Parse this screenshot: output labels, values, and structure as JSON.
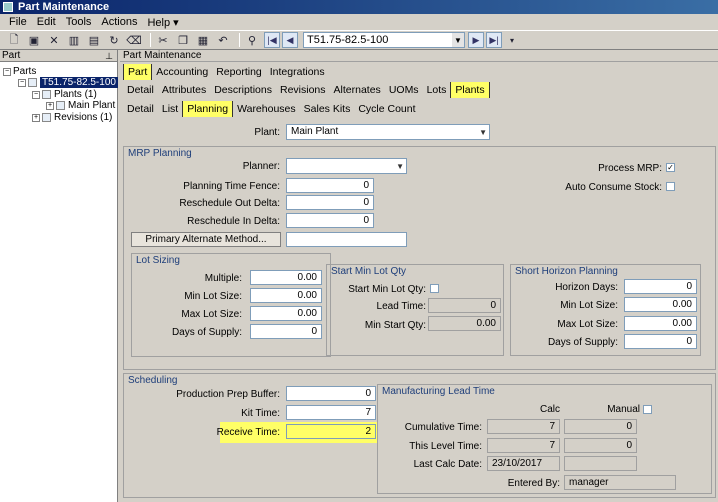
{
  "window": {
    "title": "Part Maintenance"
  },
  "menu": {
    "file": "File",
    "edit": "Edit",
    "tools": "Tools",
    "actions": "Actions",
    "help": "Help"
  },
  "toolbar": {
    "nav_value": "T51.75-82.5-100"
  },
  "tree": {
    "header": "Part",
    "root": "Parts",
    "part": "T51.75-82.5-100",
    "plants": "Plants (1)",
    "main_plant": "Main Plant",
    "revisions": "Revisions (1)"
  },
  "main": {
    "header": "Part Maintenance",
    "tabs1": [
      "Part",
      "Accounting",
      "Reporting",
      "Integrations"
    ],
    "tabs2": [
      "Detail",
      "Attributes",
      "Descriptions",
      "Revisions",
      "Alternates",
      "UOMs",
      "Lots",
      "Plants"
    ],
    "tabs3": [
      "Detail",
      "List",
      "Planning",
      "Warehouses",
      "Sales Kits",
      "Cycle Count"
    ]
  },
  "plant": {
    "label": "Plant:",
    "value": "Main Plant"
  },
  "mrp": {
    "title": "MRP Planning",
    "planner_label": "Planner:",
    "planner_value": "",
    "ptf_label": "Planning Time Fence:",
    "ptf_value": "0",
    "rod_label": "Reschedule Out Delta:",
    "rod_value": "0",
    "rid_label": "Reschedule In Delta:",
    "rid_value": "0",
    "pam_button": "Primary Alternate Method...",
    "process_mrp_label": "Process MRP:",
    "auto_consume_label": "Auto Consume Stock:"
  },
  "lot": {
    "title": "Lot Sizing",
    "multiple_label": "Multiple:",
    "multiple_value": "0.00",
    "min_label": "Min Lot Size:",
    "min_value": "0.00",
    "max_label": "Max Lot Size:",
    "max_value": "0.00",
    "days_label": "Days of Supply:",
    "days_value": "0"
  },
  "start_min": {
    "title": "Start Min Lot Qty",
    "chk_label": "Start Min Lot Qty:",
    "lead_label": "Lead Time:",
    "lead_value": "0",
    "qty_label": "Min Start Qty:",
    "qty_value": "0.00"
  },
  "short": {
    "title": "Short Horizon Planning",
    "hd_label": "Horizon Days:",
    "hd_value": "0",
    "min_label": "Min Lot Size:",
    "min_value": "0.00",
    "max_label": "Max Lot Size:",
    "max_value": "0.00",
    "days_label": "Days of Supply:",
    "days_value": "0"
  },
  "sched": {
    "title": "Scheduling",
    "ppb_label": "Production Prep Buffer:",
    "ppb_value": "0",
    "kit_label": "Kit Time:",
    "kit_value": "7",
    "recv_label": "Receive Time:",
    "recv_value": "2"
  },
  "mlt": {
    "title": "Manufacturing Lead Time",
    "calc_header": "Calc",
    "manual_header": "Manual",
    "cum_label": "Cumulative Time:",
    "cum_calc": "7",
    "cum_manual": "0",
    "tl_label": "This Level Time:",
    "tl_calc": "7",
    "tl_manual": "0",
    "lcd_label": "Last Calc Date:",
    "lcd_value": "23/10/2017",
    "eb_label": "Entered By:",
    "eb_value": "manager"
  }
}
